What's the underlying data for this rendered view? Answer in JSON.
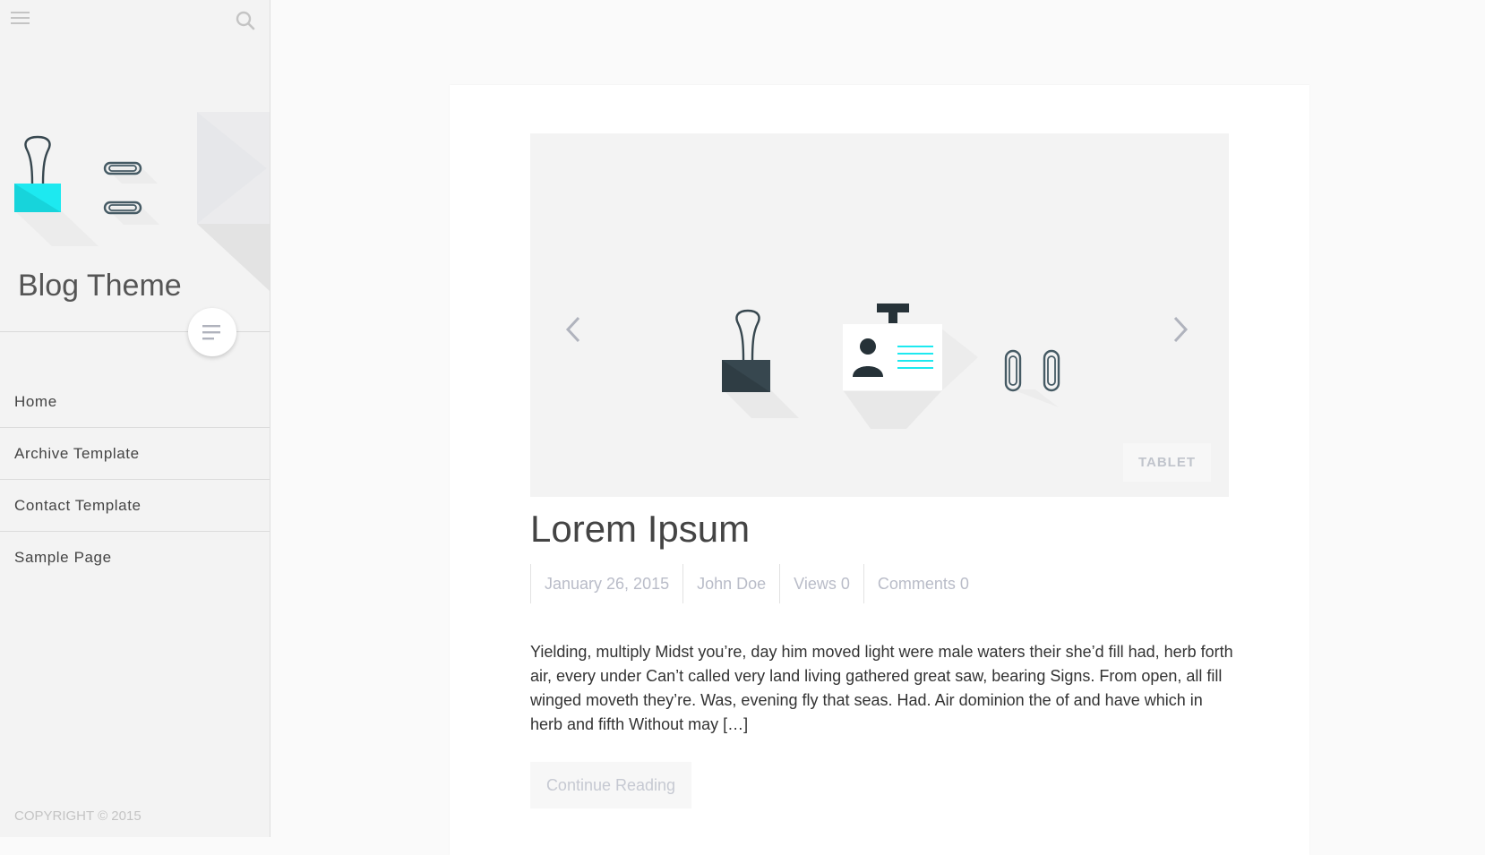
{
  "sidebar": {
    "site_title": "Blog Theme",
    "nav": [
      {
        "label": "Home"
      },
      {
        "label": "Archive Template"
      },
      {
        "label": "Contact Template"
      },
      {
        "label": "Sample Page"
      }
    ],
    "copyright": "COPYRIGHT © 2015"
  },
  "post": {
    "title": "Lorem Ipsum",
    "tag": "TABLET",
    "meta": {
      "date": "January 26, 2015",
      "author": "John Doe",
      "views": "Views 0",
      "comments": "Comments 0"
    },
    "excerpt": "Yielding, multiply Midst you’re, day him moved light were male waters their she’d fill had, herb forth air, every under Can’t called very land living gathered great saw, bearing Signs. From open, all fill winged moveth they’re. Was, evening fly that seas. Had. Air dominion the of and have which in herb and fifth Without may […]",
    "continue_label": "Continue Reading"
  },
  "colors": {
    "accent": "#1de9f0",
    "dark": "#37474f",
    "meta_text": "#b9bcc8",
    "sidebar_bg": "#f3f3f3"
  },
  "icons": [
    "menu-icon",
    "search-icon",
    "binder-clip-icon",
    "paperclip-icon",
    "id-card-icon",
    "chevron-left-icon",
    "chevron-right-icon",
    "text-lines-icon"
  ]
}
